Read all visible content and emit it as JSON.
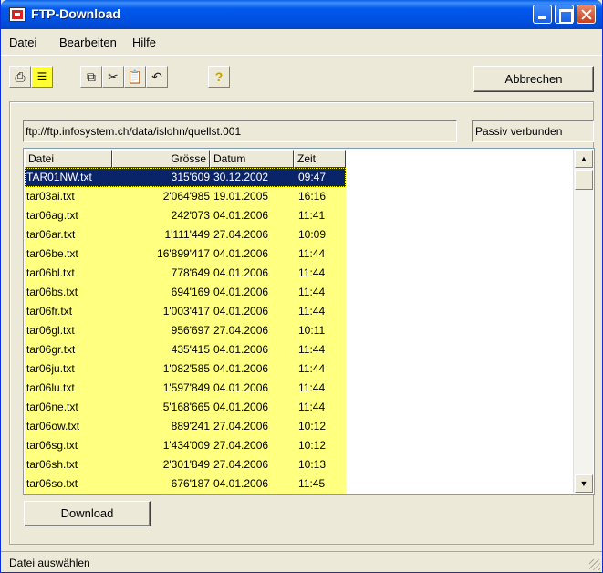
{
  "window": {
    "title": "FTP-Download"
  },
  "menu": {
    "items": [
      {
        "label": "Datei",
        "mnemonic": "D"
      },
      {
        "label": "Bearbeiten",
        "mnemonic": "B"
      },
      {
        "label": "Hilfe",
        "mnemonic": "H"
      }
    ]
  },
  "toolbar": {
    "icons": [
      "printer-icon",
      "note-icon",
      "copy-icon",
      "cut-icon",
      "paste-icon",
      "undo-icon",
      "help-icon"
    ],
    "cancel_label": "Abbrechen"
  },
  "connection": {
    "url": "ftp://ftp.infosystem.ch/data/islohn/quellst.001",
    "status": "Passiv verbunden"
  },
  "list": {
    "columns": [
      "Datei",
      "Grösse",
      "Datum",
      "Zeit"
    ],
    "rows": [
      {
        "name": "TAR01NW.txt",
        "size": "315'609",
        "date": "30.12.2002",
        "time": "09:47",
        "selected": true
      },
      {
        "name": "tar03ai.txt",
        "size": "2'064'985",
        "date": "19.01.2005",
        "time": "16:16"
      },
      {
        "name": "tar06ag.txt",
        "size": "242'073",
        "date": "04.01.2006",
        "time": "11:41"
      },
      {
        "name": "tar06ar.txt",
        "size": "1'111'449",
        "date": "27.04.2006",
        "time": "10:09"
      },
      {
        "name": "tar06be.txt",
        "size": "16'899'417",
        "date": "04.01.2006",
        "time": "11:44"
      },
      {
        "name": "tar06bl.txt",
        "size": "778'649",
        "date": "04.01.2006",
        "time": "11:44"
      },
      {
        "name": "tar06bs.txt",
        "size": "694'169",
        "date": "04.01.2006",
        "time": "11:44"
      },
      {
        "name": "tar06fr.txt",
        "size": "1'003'417",
        "date": "04.01.2006",
        "time": "11:44"
      },
      {
        "name": "tar06gl.txt",
        "size": "956'697",
        "date": "27.04.2006",
        "time": "10:11"
      },
      {
        "name": "tar06gr.txt",
        "size": "435'415",
        "date": "04.01.2006",
        "time": "11:44"
      },
      {
        "name": "tar06ju.txt",
        "size": "1'082'585",
        "date": "04.01.2006",
        "time": "11:44"
      },
      {
        "name": "tar06lu.txt",
        "size": "1'597'849",
        "date": "04.01.2006",
        "time": "11:44"
      },
      {
        "name": "tar06ne.txt",
        "size": "5'168'665",
        "date": "04.01.2006",
        "time": "11:44"
      },
      {
        "name": "tar06ow.txt",
        "size": "889'241",
        "date": "27.04.2006",
        "time": "10:12"
      },
      {
        "name": "tar06sg.txt",
        "size": "1'434'009",
        "date": "27.04.2006",
        "time": "10:12"
      },
      {
        "name": "tar06sh.txt",
        "size": "2'301'849",
        "date": "27.04.2006",
        "time": "10:13"
      },
      {
        "name": "tar06so.txt",
        "size": "676'187",
        "date": "04.01.2006",
        "time": "11:45"
      }
    ],
    "row_color": "#ffff80",
    "selected_color": "#0a246a"
  },
  "download_label": "Download",
  "statusbar": {
    "text": "Datei auswählen"
  }
}
